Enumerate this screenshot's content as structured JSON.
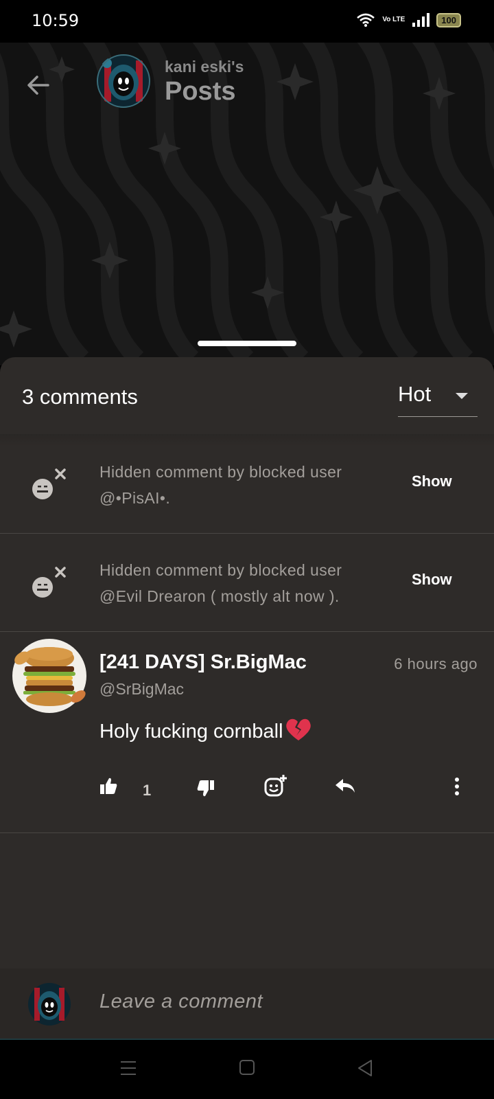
{
  "status": {
    "time": "10:59",
    "network_label": "Vo LTE",
    "battery": "100"
  },
  "header": {
    "subtitle": "kani eski's",
    "title": "Posts"
  },
  "comments_section": {
    "count_label": "3 comments",
    "sort": {
      "selected": "Hot"
    },
    "hidden_comments": [
      {
        "text": "Hidden comment by blocked user @•PisAI•.",
        "action": "Show"
      },
      {
        "text": "Hidden comment by blocked user @Evil Drearon ( mostly alt now ).",
        "action": "Show"
      }
    ],
    "comment": {
      "author": "[241 DAYS] Sr.BigMac",
      "handle": "@SrBigMac",
      "time": "6 hours ago",
      "body": "Holy fucking cornball",
      "body_emoji": "broken-heart-icon",
      "likes": "1"
    }
  },
  "composer": {
    "placeholder": "Leave a comment"
  },
  "colors": {
    "sheet_bg": "#2e2b29",
    "muted_text": "#a39f9b",
    "header_bg": "#121212"
  }
}
